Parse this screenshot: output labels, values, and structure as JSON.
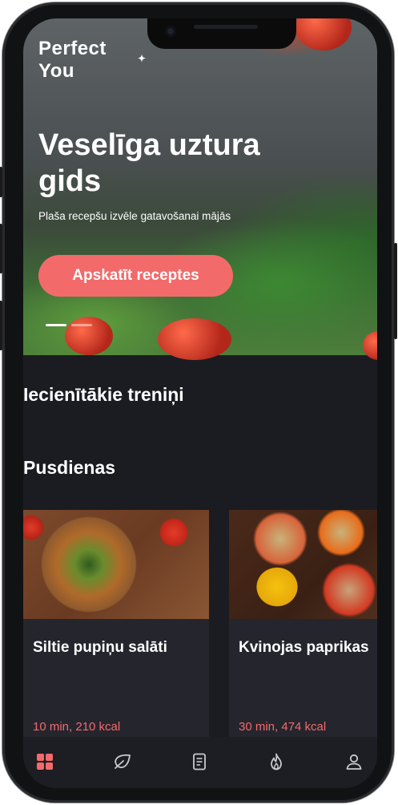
{
  "hero": {
    "logo_line1": "Perfect",
    "logo_line2": "You",
    "title": "Veselīga uztura gids",
    "subtitle": "Plaša recepšu izvēle gatavošanai mājās",
    "button_label": "Apskatīt receptes",
    "carousel_count": 2,
    "carousel_active": 1
  },
  "sections": {
    "trainings_title": "Iecienītākie treniņi",
    "lunch_title": "Pusdienas"
  },
  "recipes": [
    {
      "name": "Siltie pupiņu salāti",
      "meta": "10 min, 210 kcal"
    },
    {
      "name": "Kvinojas paprikas",
      "meta": "30 min, 474 kcal"
    }
  ],
  "nav": [
    {
      "icon": "grid-icon",
      "active": true
    },
    {
      "icon": "leaf-icon",
      "active": false
    },
    {
      "icon": "document-icon",
      "active": false
    },
    {
      "icon": "flame-icon",
      "active": false
    },
    {
      "icon": "user-icon",
      "active": false
    }
  ],
  "colors": {
    "accent": "#f36a6a",
    "background": "#1b1c21",
    "card": "#25252e",
    "text": "#ffffff"
  }
}
